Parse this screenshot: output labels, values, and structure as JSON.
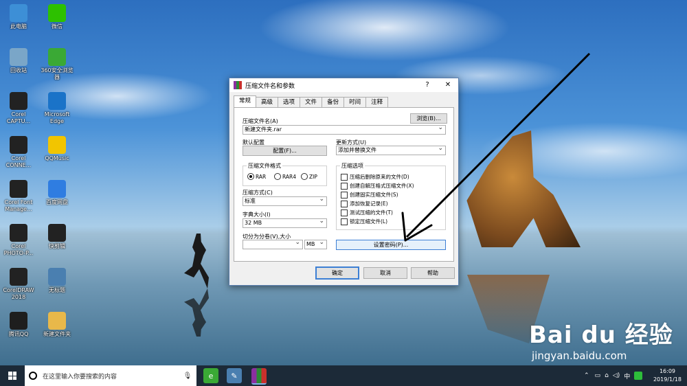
{
  "desktop_icons": [
    {
      "label": "此电脑",
      "icon": "computer-icon",
      "color": "#3d8fd6"
    },
    {
      "label": "微信",
      "icon": "wechat-icon",
      "color": "#2dc100"
    },
    {
      "label": "回收站",
      "icon": "recycle-bin-icon",
      "color": "#7aa6c8"
    },
    {
      "label": "360安全浏览器",
      "icon": "360-browser-icon",
      "color": "#3aa935"
    },
    {
      "label": "Corel CAPTU...",
      "icon": "corel-capture-icon",
      "color": "#222222"
    },
    {
      "label": "Microsoft Edge",
      "icon": "edge-icon",
      "color": "#1a73c8"
    },
    {
      "label": "Corel CONNE...",
      "icon": "corel-connect-icon",
      "color": "#222222"
    },
    {
      "label": "QQMusic",
      "icon": "qqmusic-icon",
      "color": "#f2c500"
    },
    {
      "label": "Corel Font Manage...",
      "icon": "corel-font-icon",
      "color": "#222222"
    },
    {
      "label": "百度网盘",
      "icon": "baidu-netdisk-icon",
      "color": "#2f7de1"
    },
    {
      "label": "Corel PHOTO-P...",
      "icon": "corel-photopaint-icon",
      "color": "#222222"
    },
    {
      "label": "快剪辑",
      "icon": "video-editor-icon",
      "color": "#222222"
    },
    {
      "label": "CorelDRAW 2018",
      "icon": "coreldraw-icon",
      "color": "#222222"
    },
    {
      "label": "无标题",
      "icon": "image-icon",
      "color": "#4a7fb0"
    },
    {
      "label": "腾讯QQ",
      "icon": "qq-icon",
      "color": "#1e1e1e"
    },
    {
      "label": "新建文件夹",
      "icon": "folder-icon",
      "color": "#e8b84a"
    }
  ],
  "dialog": {
    "title": "压缩文件名和参数",
    "help_btn": "?",
    "close_btn": "✕",
    "tabs": [
      "常规",
      "高级",
      "选项",
      "文件",
      "备份",
      "时间",
      "注释"
    ],
    "archive_name_label": "压缩文件名(A)",
    "browse_button": "浏览(B)...",
    "archive_name_value": "新建文件夹.rar",
    "default_profile_label": "默认配置",
    "profile_button": "配置(F)...",
    "update_mode_label": "更新方式(U)",
    "update_mode_value": "添加并替换文件",
    "format_group_title": "压缩文件格式",
    "formats": [
      "RAR",
      "RAR4",
      "ZIP"
    ],
    "options_group_title": "压缩选项",
    "options": [
      "压缩后删除原来的文件(D)",
      "创建自解压格式压缩文件(X)",
      "创建固实压缩文件(S)",
      "添加恢复记录(E)",
      "测试压缩的文件(T)",
      "锁定压缩文件(L)"
    ],
    "method_label": "压缩方式(C)",
    "method_value": "标准",
    "dict_label": "字典大小(I)",
    "dict_value": "32 MB",
    "split_label": "切分为分卷(V),大小",
    "split_value": "",
    "split_unit": "MB",
    "set_password_button": "设置密码(P)...",
    "ok_button": "确定",
    "cancel_button": "取消",
    "help_button": "帮助"
  },
  "taskbar": {
    "search_placeholder": "在这里输入你要搜索的内容",
    "time": "16:09",
    "date": "2019/1/18",
    "ime": "中"
  },
  "watermark": {
    "brand": "Bai du 经验",
    "url": "jingyan.baidu.com"
  }
}
